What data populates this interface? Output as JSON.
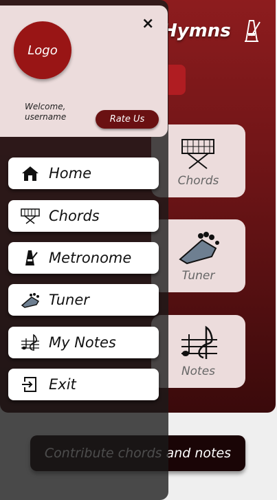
{
  "background": {
    "app_title": "Hymns",
    "cards": [
      {
        "label": "Chords",
        "icon": "keyboard-icon"
      },
      {
        "label": "Tuner",
        "icon": "guitar-head-icon"
      },
      {
        "label": "Notes",
        "icon": "music-notes-icon"
      }
    ],
    "contribute_label": "Contribute chords and notes"
  },
  "drawer": {
    "close_label": "×",
    "logo_label": "Logo",
    "welcome_line1": "Welcome,",
    "welcome_line2": "username",
    "rate_label": "Rate Us",
    "items": [
      {
        "label": "Home",
        "icon": "home-icon"
      },
      {
        "label": "Chords",
        "icon": "keyboard-icon"
      },
      {
        "label": "Metronome",
        "icon": "metronome-icon"
      },
      {
        "label": "Tuner",
        "icon": "guitar-head-icon"
      },
      {
        "label": "My Notes",
        "icon": "music-notes-icon"
      },
      {
        "label": "Exit",
        "icon": "exit-icon"
      }
    ]
  },
  "colors": {
    "brand_red": "#8d1c1e",
    "drawer_header": "#ecdcdc",
    "rate_button": "#6a1112"
  }
}
